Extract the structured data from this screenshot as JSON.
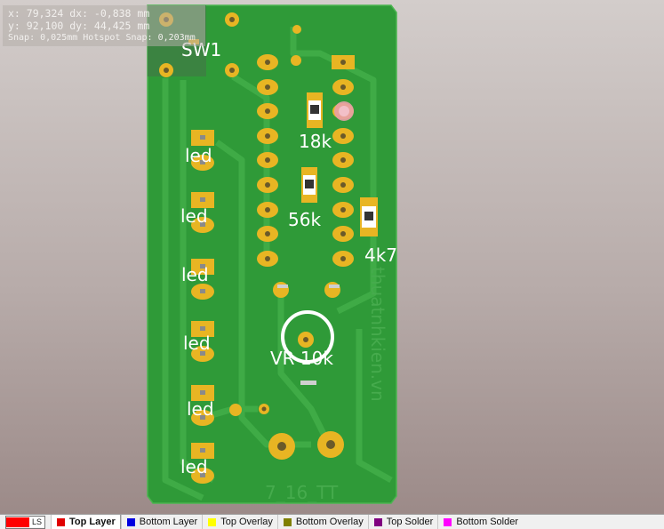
{
  "readout": {
    "x_line": "x: 79,324   dx: -0,838  mm",
    "y_line": "y: 92,100   dy: 44,425  mm",
    "snap_line": "Snap: 0,025mm Hotspot Snap: 0,203mm"
  },
  "board": {
    "designators": {
      "switch": "SW1",
      "r1": "18k",
      "r2": "56k",
      "r3": "4k7",
      "pot": "VR 10k",
      "leds": [
        "led",
        "led",
        "led",
        "led",
        "led",
        "led"
      ]
    },
    "watermark_url": "thuatnhkien.vn",
    "bottom_code": "7_16_TT"
  },
  "layer_bar": {
    "ls_label": "LS",
    "tabs": [
      {
        "label": "Top Layer",
        "color": "#e00000",
        "active": true
      },
      {
        "label": "Bottom Layer",
        "color": "#0000e0",
        "active": false
      },
      {
        "label": "Top Overlay",
        "color": "#ffff00",
        "active": false
      },
      {
        "label": "Bottom Overlay",
        "color": "#808000",
        "active": false
      },
      {
        "label": "Top Solder",
        "color": "#800080",
        "active": false
      },
      {
        "label": "Bottom Solder",
        "color": "#ff00ff",
        "active": false
      }
    ]
  },
  "colors": {
    "board": "#2f9a38",
    "pad": "#e8b523",
    "silkscreen": "#ffffff"
  }
}
